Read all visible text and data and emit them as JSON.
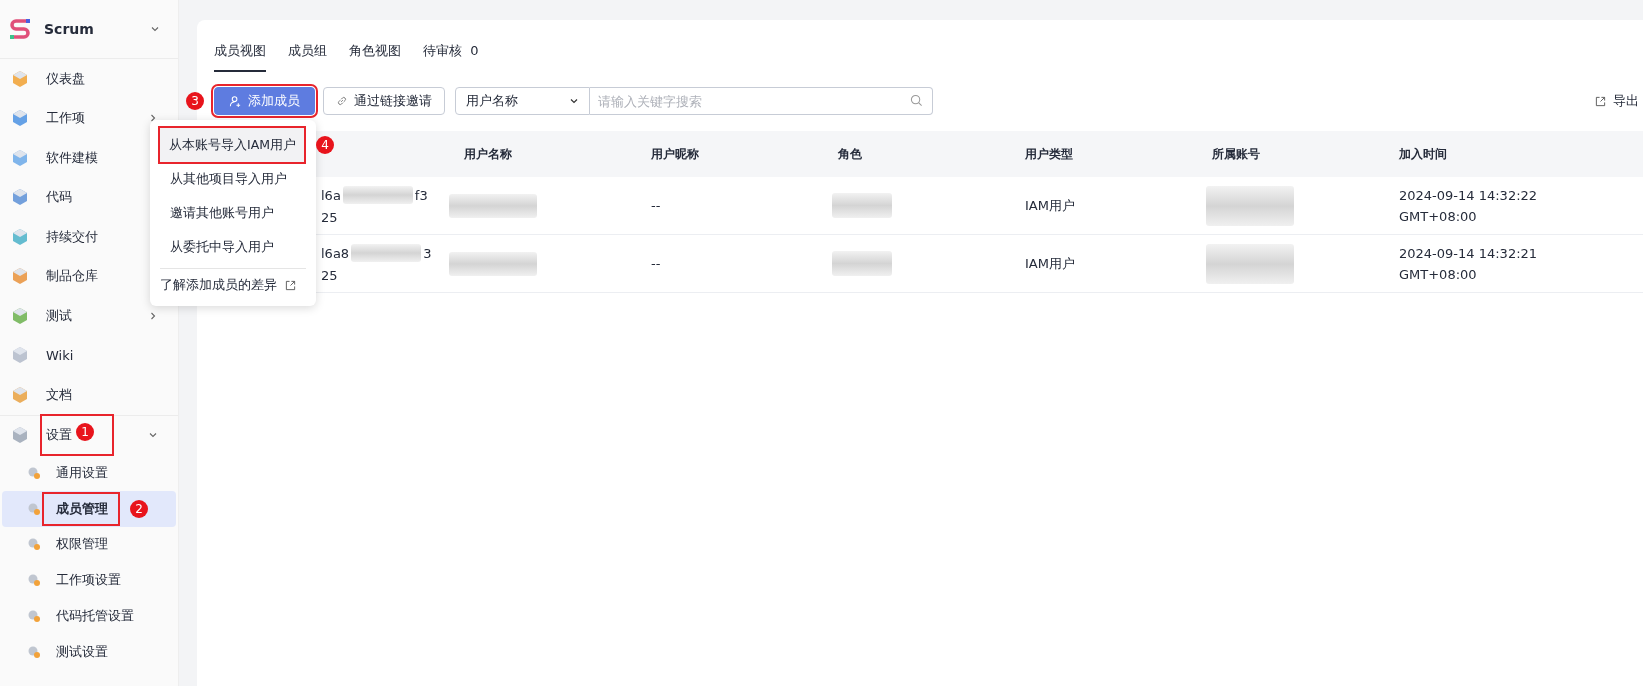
{
  "project": {
    "name": "Scrum"
  },
  "sidebar": {
    "items": [
      {
        "label": "仪表盘",
        "has_arrow": false,
        "highlighted": false
      },
      {
        "label": "工作项",
        "has_arrow": true,
        "highlighted": false
      },
      {
        "label": "软件建模",
        "has_arrow": false,
        "highlighted": false
      },
      {
        "label": "代码",
        "has_arrow": false,
        "highlighted": false
      },
      {
        "label": "持续交付",
        "has_arrow": false,
        "highlighted": false
      },
      {
        "label": "制品仓库",
        "has_arrow": false,
        "highlighted": false
      },
      {
        "label": "测试",
        "has_arrow": true,
        "highlighted": false
      },
      {
        "label": "Wiki",
        "has_arrow": false,
        "highlighted": false
      },
      {
        "label": "文档",
        "has_arrow": false,
        "highlighted": false
      },
      {
        "label": "设置",
        "expanded": true,
        "has_arrow": true,
        "highlighted": true,
        "marker": "1",
        "children": [
          {
            "label": "通用设置",
            "selected": false,
            "highlighted": false
          },
          {
            "label": "成员管理",
            "selected": true,
            "highlighted": true,
            "marker": "2"
          },
          {
            "label": "权限管理",
            "selected": false,
            "highlighted": false
          },
          {
            "label": "工作项设置",
            "selected": false,
            "highlighted": false
          },
          {
            "label": "代码托管设置",
            "selected": false,
            "highlighted": false
          },
          {
            "label": "测试设置",
            "selected": false,
            "highlighted": false
          }
        ]
      }
    ]
  },
  "tabs": [
    {
      "label": "成员视图",
      "selected": true
    },
    {
      "label": "成员组",
      "selected": false
    },
    {
      "label": "角色视图",
      "selected": false
    },
    {
      "label": "待审核",
      "count": "0",
      "selected": false
    }
  ],
  "toolbar": {
    "add_button": {
      "label": "添加成员",
      "highlighted": true,
      "marker": "3"
    },
    "invite_button": {
      "label": "通过链接邀请"
    },
    "filter_select": {
      "value": "用户名称"
    },
    "search": {
      "placeholder": "请输入关键字搜索"
    },
    "export_link": {
      "label": "导出"
    }
  },
  "add_menu": {
    "items": [
      {
        "label": "从本账号导入IAM用户",
        "selected": true,
        "highlighted": true,
        "marker": "4"
      },
      {
        "label": "从其他项目导入用户",
        "selected": false,
        "highlighted": false
      },
      {
        "label": "邀请其他账号用户",
        "selected": false,
        "highlighted": false
      },
      {
        "label": "从委托中导入用户",
        "selected": false,
        "highlighted": false
      }
    ],
    "footer_link": {
      "label": "了解添加成员的差异"
    }
  },
  "table": {
    "columns": [
      "用户名称",
      "用户昵称",
      "角色",
      "用户类型",
      "所属账号",
      "加入时间"
    ],
    "rows": [
      {
        "id_start": "l6a",
        "id_blurred": true,
        "id_end": "f3",
        "id_line2": "25",
        "user_name_blurred": true,
        "nickname": "--",
        "role_blurred": true,
        "user_type": "IAM用户",
        "account_blurred": true,
        "joined": "2024-09-14 14:32:22",
        "joined_tz": "GMT+08:00"
      },
      {
        "id_start": "l6a8",
        "id_blurred": true,
        "id_end": "3",
        "id_line2": "25",
        "user_name_blurred": true,
        "nickname": "--",
        "role_blurred": true,
        "user_type": "IAM用户",
        "account_blurred": true,
        "joined": "2024-09-14 14:32:21",
        "joined_tz": "GMT+08:00"
      }
    ]
  }
}
